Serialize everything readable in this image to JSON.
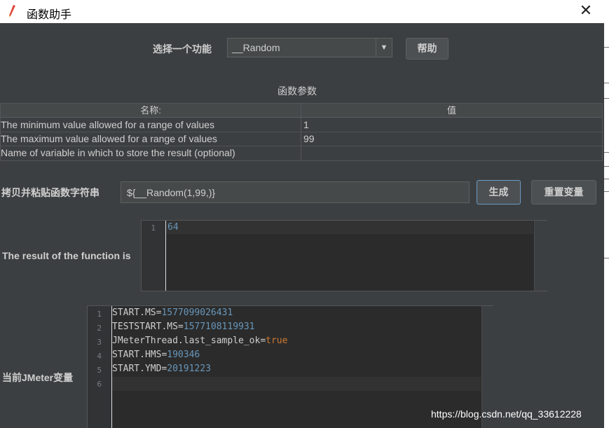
{
  "window": {
    "title": "函数助手",
    "close_glyph": "✕",
    "app_icon": "pencil-icon"
  },
  "function_select": {
    "label": "选择一个功能",
    "selected": "__Random",
    "arrow_glyph": "▼",
    "help_label": "帮助"
  },
  "params": {
    "section_title": "函数参数",
    "columns": [
      "名称:",
      "值"
    ],
    "rows": [
      {
        "name": "The minimum value allowed for a range of values",
        "value": "1"
      },
      {
        "name": "The maximum value allowed for a range of values",
        "value": "99"
      },
      {
        "name": "Name of variable in which to store the result (optional)",
        "value": ""
      }
    ]
  },
  "copy": {
    "label": "拷贝并粘贴函数字符串",
    "value": "${__Random(1,99,)}",
    "generate_label": "生成",
    "reset_label": "重置变量"
  },
  "result": {
    "label": "The result of the function is",
    "lines": [
      {
        "no": "1",
        "text": "64"
      }
    ]
  },
  "variables": {
    "label": "当前JMeter变量",
    "lines": [
      {
        "no": "1",
        "key": "START.MS=",
        "val": "1577099026431"
      },
      {
        "no": "2",
        "key": "TESTSTART.MS=",
        "val": "1577108119931"
      },
      {
        "no": "3",
        "key": "JMeterThread.last_sample_ok=",
        "val": "true"
      },
      {
        "no": "4",
        "key": "START.HMS=",
        "val": "190346"
      },
      {
        "no": "5",
        "key": "START.YMD=",
        "val": "20191223"
      },
      {
        "no": "6",
        "key": "",
        "val": ""
      }
    ]
  },
  "watermark": "https://blog.csdn.net/qq_33612228",
  "colors": {
    "background": "#3c3f41",
    "editor_bg": "#2b2b2b",
    "number": "#6897bb",
    "keyword": "#cc7832",
    "text": "#cfcfcf"
  }
}
